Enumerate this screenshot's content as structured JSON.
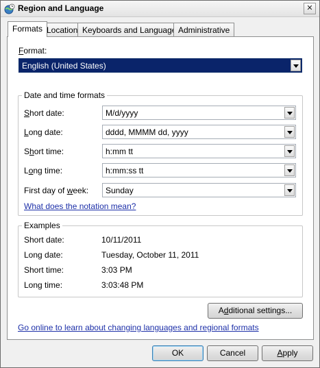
{
  "window": {
    "title": "Region and Language",
    "close_glyph": "✕"
  },
  "tabs": [
    {
      "label": "Formats",
      "active": true
    },
    {
      "label": "Location",
      "active": false
    },
    {
      "label": "Keyboards and Languages",
      "active": false
    },
    {
      "label": "Administrative",
      "active": false
    }
  ],
  "format": {
    "label_u": "F",
    "label_rest": "ormat:",
    "value": "English (United States)"
  },
  "datetime": {
    "group_title": "Date and time formats",
    "short_date": {
      "label_u": "S",
      "label_rest": "hort date:",
      "value": "M/d/yyyy"
    },
    "long_date": {
      "label_u": "L",
      "label_rest": "ong date:",
      "value": "dddd, MMMM dd, yyyy"
    },
    "short_time": {
      "label_pre": "S",
      "label_u": "h",
      "label_rest": "ort time:",
      "value": "h:mm tt"
    },
    "long_time": {
      "label_pre": "L",
      "label_u": "o",
      "label_rest": "ng time:",
      "value": "h:mm:ss tt"
    },
    "first_day": {
      "label_pre": "First day of ",
      "label_u": "w",
      "label_rest": "eek:",
      "value": "Sunday"
    },
    "notation_link": "What does the notation mean?"
  },
  "examples": {
    "group_title": "Examples",
    "rows": [
      {
        "label": "Short date:",
        "value": "10/11/2011"
      },
      {
        "label": "Long date:",
        "value": "Tuesday, October 11, 2011"
      },
      {
        "label": "Short time:",
        "value": "3:03 PM"
      },
      {
        "label": "Long time:",
        "value": "3:03:48 PM"
      }
    ]
  },
  "additional_settings": {
    "pre": "A",
    "u": "d",
    "rest": "ditional settings..."
  },
  "online_link": "Go online to learn about changing languages and regional formats",
  "buttons": {
    "ok": "OK",
    "cancel": "Cancel",
    "apply_u": "A",
    "apply_rest": "pply"
  },
  "colors": {
    "selection": "#0a246a",
    "link": "#1c2fa8"
  }
}
